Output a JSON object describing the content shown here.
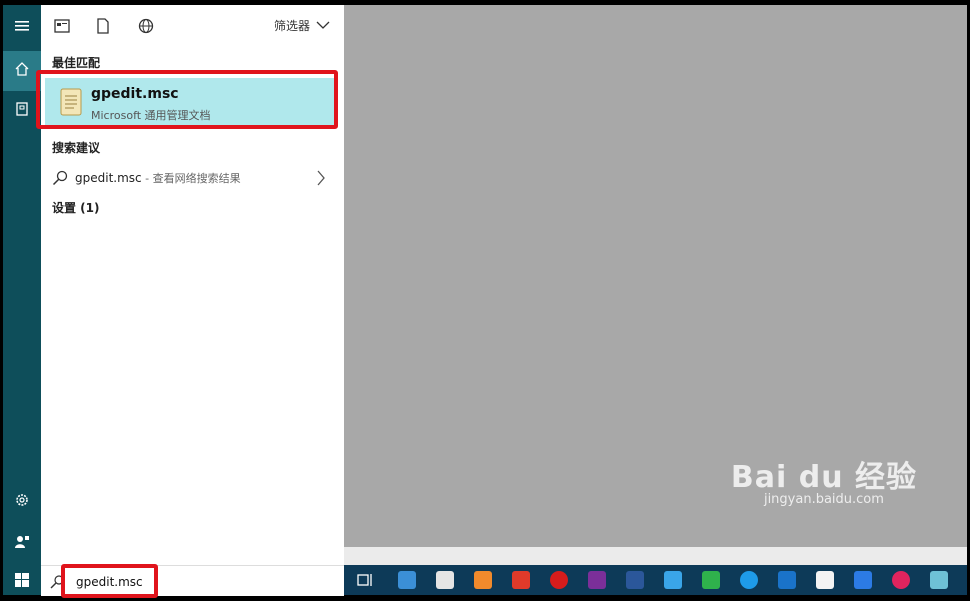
{
  "toolbar": {
    "filter_label": "筛选器"
  },
  "best_match": {
    "section_title": "最佳匹配",
    "title": "gpedit.msc",
    "subtitle": "Microsoft 通用管理文档"
  },
  "suggestions": {
    "section_title": "搜索建议",
    "item": {
      "query": "gpedit.msc",
      "desc": " - 查看网络搜索结果"
    }
  },
  "settings": {
    "section_title": "设置 (1)"
  },
  "search": {
    "value": "gpedit.msc"
  },
  "watermark": {
    "logo": "Bai du 经验",
    "url": "jingyan.baidu.com"
  },
  "colors": {
    "rail": "#0e4e5a",
    "highlight": "#b0e8ec",
    "frame": "#e0141c",
    "desktop": "#a8a8a8",
    "taskbar": "#0d3a58"
  }
}
